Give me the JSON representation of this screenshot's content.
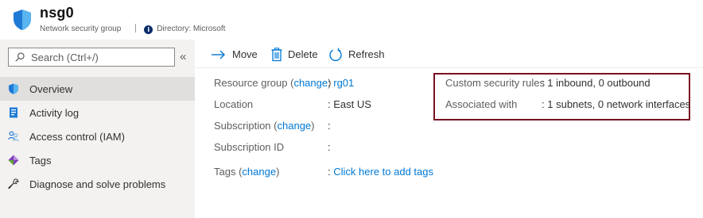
{
  "header": {
    "title": "nsg0",
    "subtitle": "Network security group",
    "directory_label": "Directory: Microsoft"
  },
  "sidebar": {
    "search": {
      "placeholder": "Search (Ctrl+/)"
    },
    "collapse_glyph": "«",
    "items": [
      {
        "label": "Overview",
        "icon": "shield-icon",
        "active": true
      },
      {
        "label": "Activity log",
        "icon": "activity-log-icon",
        "active": false
      },
      {
        "label": "Access control (IAM)",
        "icon": "people-icon",
        "active": false
      },
      {
        "label": "Tags",
        "icon": "tag-icon",
        "active": false
      },
      {
        "label": "Diagnose and solve problems",
        "icon": "wrench-icon",
        "active": false
      }
    ]
  },
  "toolbar": {
    "move_label": "Move",
    "delete_label": "Delete",
    "refresh_label": "Refresh"
  },
  "essentials": {
    "resource_group": {
      "label": "Resource group",
      "change": "change",
      "close": ")",
      "open": " (",
      "sep": ":",
      "value": "rg01"
    },
    "location": {
      "label": "Location",
      "sep": ":",
      "value": "East US"
    },
    "subscription": {
      "label": "Subscription",
      "change": "change",
      "open": " (",
      "close": ")",
      "sep": ":",
      "value": ""
    },
    "subscription_id": {
      "label": "Subscription ID",
      "sep": ":",
      "value": ""
    },
    "tags": {
      "label": "Tags",
      "change": "change",
      "open": " (",
      "close": ")",
      "sep": ":",
      "value": "Click here to add tags"
    },
    "custom_security_rules": {
      "label": "Custom security rules",
      "sep": ":",
      "value": "1 inbound, 0 outbound"
    },
    "associated_with": {
      "label": "Associated with",
      "sep": ":",
      "value": "1 subnets, 0 network interfaces"
    }
  },
  "colors": {
    "accent": "#0078d4",
    "highlight_border": "#7a1022",
    "sidebar_bg": "#f3f2f1",
    "active_item_bg": "#e1dfdd"
  }
}
